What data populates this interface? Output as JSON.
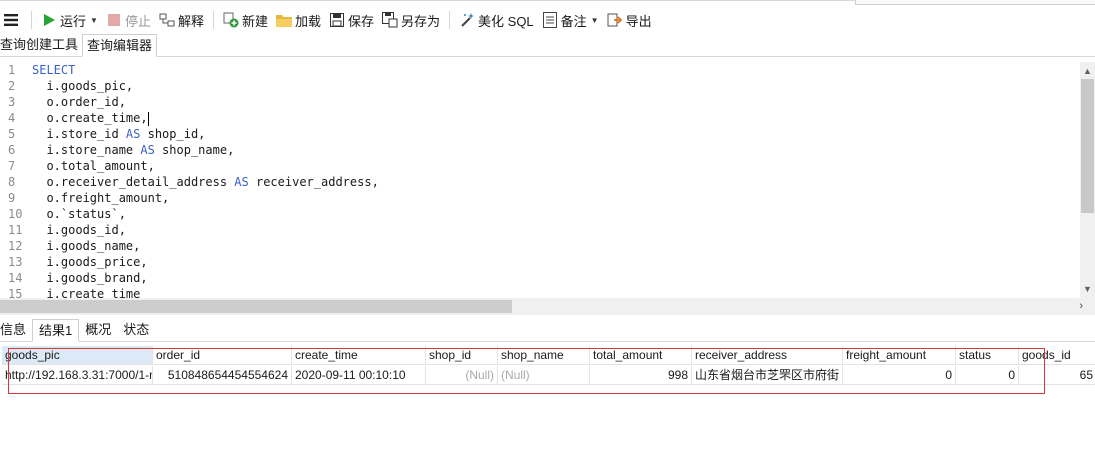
{
  "toolbar": {
    "run_label": "运行",
    "stop_label": "停止",
    "explain_label": "解释",
    "new_label": "新建",
    "load_label": "加载",
    "save_label": "保存",
    "save_as_label": "另存为",
    "beautify_label": "美化 SQL",
    "comment_label": "备注",
    "export_label": "导出"
  },
  "subtabs": [
    "查询创建工具",
    "查询编辑器"
  ],
  "editor": {
    "lines": [
      {
        "n": "1",
        "parts": [
          {
            "t": "SELECT",
            "k": true
          }
        ]
      },
      {
        "n": "2",
        "parts": [
          {
            "t": "  i.goods_pic,",
            "k": false
          }
        ]
      },
      {
        "n": "3",
        "parts": [
          {
            "t": "  o.order_id,",
            "k": false
          }
        ]
      },
      {
        "n": "4",
        "parts": [
          {
            "t": "  o.create_time,",
            "k": false
          }
        ],
        "cursor": true
      },
      {
        "n": "5",
        "parts": [
          {
            "t": "  i.store_id ",
            "k": false
          },
          {
            "t": "AS",
            "k": true
          },
          {
            "t": " shop_id,",
            "k": false
          }
        ]
      },
      {
        "n": "6",
        "parts": [
          {
            "t": "  i.store_name ",
            "k": false
          },
          {
            "t": "AS",
            "k": true
          },
          {
            "t": " shop_name,",
            "k": false
          }
        ]
      },
      {
        "n": "7",
        "parts": [
          {
            "t": "  o.total_amount,",
            "k": false
          }
        ]
      },
      {
        "n": "8",
        "parts": [
          {
            "t": "  o.receiver_detail_address ",
            "k": false
          },
          {
            "t": "AS",
            "k": true
          },
          {
            "t": " receiver_address,",
            "k": false
          }
        ]
      },
      {
        "n": "9",
        "parts": [
          {
            "t": "  o.freight_amount,",
            "k": false
          }
        ]
      },
      {
        "n": "10",
        "parts": [
          {
            "t": "  o.`status`,",
            "k": false
          }
        ]
      },
      {
        "n": "11",
        "parts": [
          {
            "t": "  i.goods_id,",
            "k": false
          }
        ]
      },
      {
        "n": "12",
        "parts": [
          {
            "t": "  i.goods_name,",
            "k": false
          }
        ]
      },
      {
        "n": "13",
        "parts": [
          {
            "t": "  i.goods_price,",
            "k": false
          }
        ]
      },
      {
        "n": "14",
        "parts": [
          {
            "t": "  i.goods_brand,",
            "k": false
          }
        ]
      },
      {
        "n": "15",
        "parts": [
          {
            "t": "  i.create_time",
            "k": false
          }
        ]
      }
    ]
  },
  "result_tabs": [
    "信息",
    "结果1",
    "概况",
    "状态"
  ],
  "grid": {
    "columns": [
      {
        "name": "goods_pic",
        "w": 151
      },
      {
        "name": "order_id",
        "w": 139
      },
      {
        "name": "create_time",
        "w": 134
      },
      {
        "name": "shop_id",
        "w": 72
      },
      {
        "name": "shop_name",
        "w": 92
      },
      {
        "name": "total_amount",
        "w": 102
      },
      {
        "name": "receiver_address",
        "w": 151
      },
      {
        "name": "freight_amount",
        "w": 113
      },
      {
        "name": "status",
        "w": 63
      },
      {
        "name": "goods_id",
        "w": 78
      }
    ],
    "row": [
      "http://192.168.3.31:7000/1-n",
      "510848654454554624",
      "2020-09-11 00:10:10",
      "(Null)",
      "(Null)",
      "998",
      "山东省烟台市芝罘区市府街",
      "0",
      "0",
      "65"
    ]
  }
}
